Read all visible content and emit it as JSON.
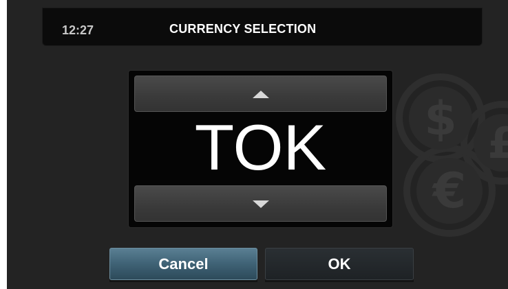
{
  "header": {
    "time": "12:27",
    "title": "CURRENCY SELECTION"
  },
  "spinner": {
    "up_icon": "triangle-up-icon",
    "down_icon": "triangle-down-icon",
    "value": "TOK"
  },
  "background": {
    "icon": "coins-icon",
    "coin_symbols": [
      "$",
      "£",
      "€"
    ]
  },
  "buttons": {
    "cancel_label": "Cancel",
    "ok_label": "OK"
  },
  "colors": {
    "screen_bg": "#232323",
    "header_bg": "#0b0b0b",
    "cancel_accent": "#3f6275",
    "ok_bg": "#1e2225"
  }
}
